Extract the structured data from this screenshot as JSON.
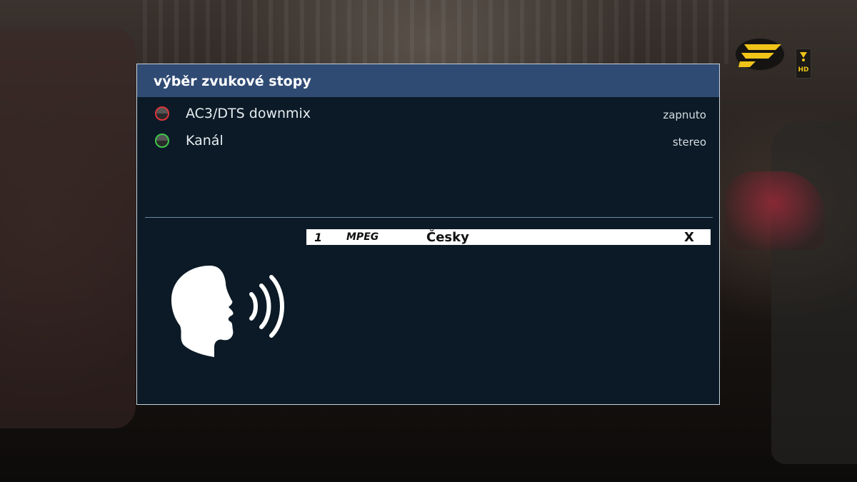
{
  "dialog": {
    "title": "výběr zvukové stopy",
    "options": [
      {
        "button_color": "#e0343a",
        "label": "AC3/DTS downmix",
        "value": "zapnuto"
      },
      {
        "button_color": "#3dc74a",
        "label": "Kanál",
        "value": "stereo"
      }
    ],
    "tracks": [
      {
        "number": "1",
        "codec": "MPEG",
        "language": "Česky",
        "mark": "X",
        "selected": true
      }
    ],
    "illustration": "speaking-head-icon"
  },
  "status": {
    "badge_text": "HD",
    "logo": "provider-logo",
    "accent_color": "#f0c419"
  },
  "colors": {
    "header": "#2f4b74",
    "panel": "#0b1a26",
    "highlight_row": "#ffffff"
  }
}
